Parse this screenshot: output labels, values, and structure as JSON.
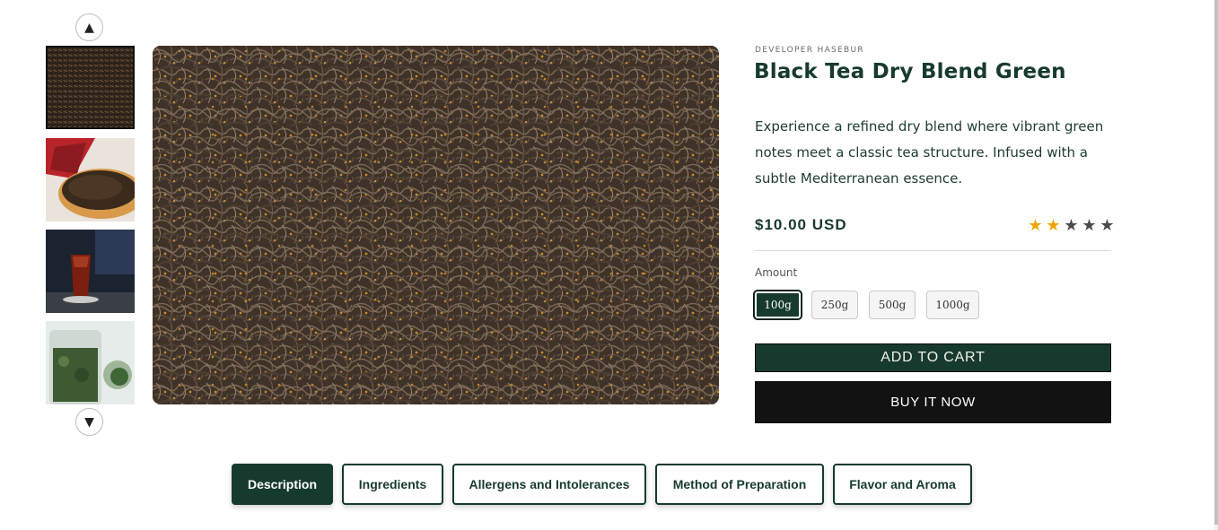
{
  "gallery": {
    "nav_up_icon": "triangle-up-icon",
    "nav_down_icon": "triangle-down-icon",
    "nav_up_glyph": "▲",
    "nav_down_glyph": "▼"
  },
  "product": {
    "vendor": "DEVELOPER HASEBUR",
    "title": "Black Tea Dry Blend Green",
    "description": "Experience a refined dry blend where vibrant green notes meet a classic tea structure. Infused with a subtle Mediterranean essence.",
    "price": "$10.00 USD",
    "rating": 2,
    "rating_max": 5
  },
  "amount": {
    "label": "Amount",
    "options": [
      "100g",
      "250g",
      "500g",
      "1000g"
    ],
    "selected": "100g"
  },
  "actions": {
    "add_to_cart": "ADD TO CART",
    "buy_now": "BUY IT NOW"
  },
  "tabs": [
    {
      "label": "Description",
      "active": true
    },
    {
      "label": "Ingredients",
      "active": false
    },
    {
      "label": "Allergens and Intolerances",
      "active": false
    },
    {
      "label": "Method of Preparation",
      "active": false
    },
    {
      "label": "Flavor and Aroma",
      "active": false
    }
  ],
  "colors": {
    "brand": "#173a2f",
    "star_on": "#f0a500",
    "star_off": "#4a4a4a",
    "buy_now_bg": "#121212"
  }
}
